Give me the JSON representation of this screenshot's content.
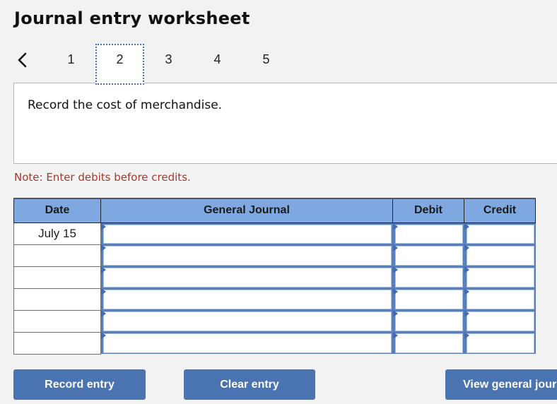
{
  "header": {
    "title": "Journal entry worksheet"
  },
  "pagination": {
    "prev_icon": "chevron-left-icon",
    "pages": [
      "1",
      "2",
      "3",
      "4",
      "5"
    ],
    "active_page": "2"
  },
  "instruction": {
    "text": "Record the cost of merchandise."
  },
  "note": {
    "text": "Note: Enter debits before credits."
  },
  "journal": {
    "columns": [
      "Date",
      "General Journal",
      "Debit",
      "Credit"
    ],
    "rows": [
      {
        "date": "July 15",
        "account": "",
        "debit": "",
        "credit": ""
      },
      {
        "date": "",
        "account": "",
        "debit": "",
        "credit": ""
      },
      {
        "date": "",
        "account": "",
        "debit": "",
        "credit": ""
      },
      {
        "date": "",
        "account": "",
        "debit": "",
        "credit": ""
      },
      {
        "date": "",
        "account": "",
        "debit": "",
        "credit": ""
      },
      {
        "date": "",
        "account": "",
        "debit": "",
        "credit": ""
      }
    ]
  },
  "buttons": {
    "record": "Record entry",
    "clear": "Clear entry",
    "view": "View general journal"
  },
  "colors": {
    "header_bg": "#80a8e0",
    "button_bg": "#4a73b1",
    "note_text": "#a33a32",
    "input_frame": "#5b7fb8"
  }
}
